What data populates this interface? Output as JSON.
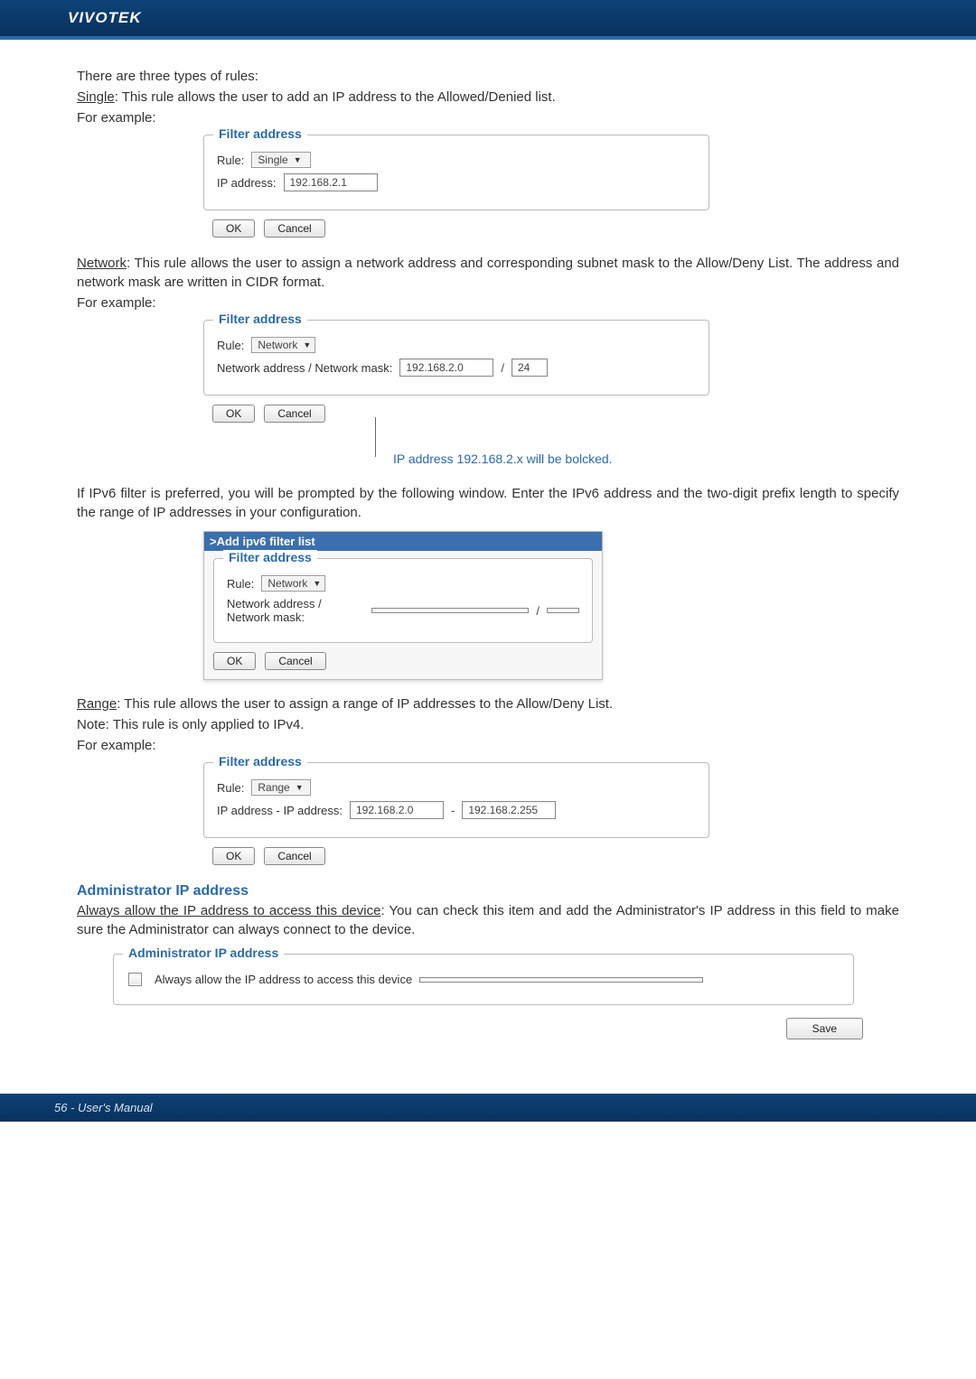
{
  "brand": "VIVOTEK",
  "intro": {
    "line1": "There are three types of rules:",
    "single_def": ": This rule allows the user to add an IP address to the Allowed/Denied list.",
    "for_example": "For example:"
  },
  "labels": {
    "single": "Single",
    "network": "Network",
    "range": "Range"
  },
  "widget_common": {
    "legend": "Filter address",
    "rule_label": "Rule:",
    "ok": "OK",
    "cancel": "Cancel"
  },
  "single_widget": {
    "rule_value": "Single",
    "ip_label": "IP address:",
    "ip_value": "192.168.2.1"
  },
  "network_intro": ": This rule allows the user to assign a network address and corresponding subnet mask to the Allow/Deny List. The address and network mask are written in CIDR format.",
  "network_widget": {
    "rule_value": "Network",
    "addr_label": "Network address / Network mask:",
    "addr_value": "192.168.2.0",
    "mask_sep": "/",
    "mask_value": "24"
  },
  "network_callout": "IP address 192.168.2.x will be bolcked.",
  "ipv6_intro": "If IPv6 filter is preferred, you will be prompted by the following window. Enter the IPv6 address and the two-digit prefix length to specify the range of IP addresses in your configuration.",
  "ipv6_widget": {
    "banner": ">Add ipv6 filter list",
    "rule_value": "Network",
    "addr_label": "Network address / Network mask:",
    "addr_value": "",
    "mask_sep": "/",
    "mask_value": ""
  },
  "range_intro": ": This rule allows the user to assign a range of IP addresses to the Allow/Deny List.",
  "range_note": "Note: This rule is only applied to IPv4.",
  "range_widget": {
    "rule_value": "Range",
    "addr_label": "IP address - IP address:",
    "from_value": "192.168.2.0",
    "sep": "-",
    "to_value": "192.168.2.255"
  },
  "admin": {
    "heading": "Administrator IP address",
    "lead_u": "Always allow the IP address to access this device",
    "lead_rest": ": You can check this item and add the Administrator's IP address in this field to make sure the Administrator can always connect to the device.",
    "legend": "Administrator IP address",
    "checkbox_label": "Always allow the IP address to access this device",
    "ip_value": ""
  },
  "save_label": "Save",
  "footer": "56 - User's Manual"
}
